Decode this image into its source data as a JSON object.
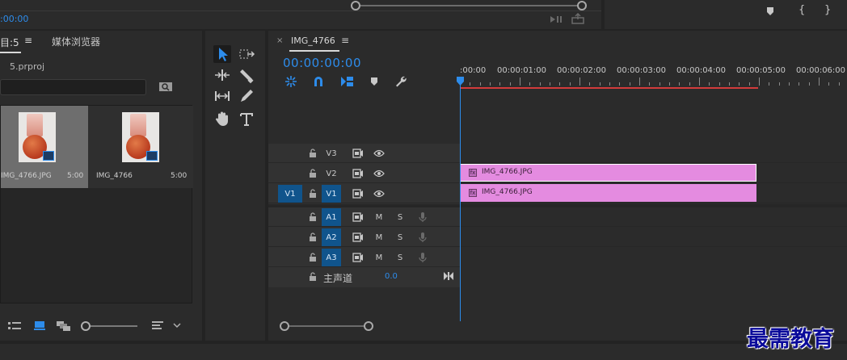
{
  "top": {
    "source_time": ":00:00"
  },
  "project": {
    "tab_label": "目:5",
    "menu_glyph": "≡",
    "media_browser_tab": "媒体浏览器",
    "file_name": "5.prproj",
    "items": [
      {
        "name": "IMG_4766.JPG",
        "duration": "5:00"
      },
      {
        "name": "IMG_4766",
        "duration": "5:00"
      }
    ]
  },
  "timeline": {
    "close_glyph": "×",
    "sequence_name": "IMG_4766",
    "menu_glyph": "≡",
    "timecode": "00:00:00:00",
    "ruler_ticks": [
      ":00:00",
      "00:00:01:00",
      "00:00:02:00",
      "00:00:03:00",
      "00:00:04:00",
      "00:00:05:00",
      "00:00:06:00"
    ],
    "tracks": [
      {
        "id": "V3",
        "kind": "video",
        "source": ""
      },
      {
        "id": "V2",
        "kind": "video",
        "source": ""
      },
      {
        "id": "V1",
        "kind": "video",
        "source": "V1"
      },
      {
        "id": "A1",
        "kind": "audio",
        "mute": "M",
        "solo": "S"
      },
      {
        "id": "A2",
        "kind": "audio",
        "mute": "M",
        "solo": "S"
      },
      {
        "id": "A3",
        "kind": "audio",
        "mute": "M",
        "solo": "S"
      }
    ],
    "master": {
      "label": "主声道",
      "value": "0.0"
    },
    "clips": [
      {
        "track": "V2",
        "name": "IMG_4766.JPG"
      },
      {
        "track": "V1",
        "name": "IMG_4766.JPG"
      }
    ]
  },
  "watermark": "最需教育",
  "colors": {
    "accent_blue": "#2d8ceb",
    "track_target_blue": "#10548c",
    "clip_pink": "#e48be0",
    "work_area_red": "#d23b3b"
  },
  "icons": [
    "select-tool-icon",
    "track-select-icon",
    "ripple-edit-icon",
    "razor-icon",
    "slip-icon",
    "pen-icon",
    "hand-icon",
    "type-icon",
    "snap-icon",
    "linked-selection-icon",
    "add-marker-icon",
    "wrench-icon",
    "lock-icon",
    "toggle-output-icon",
    "eye-icon",
    "mic-icon"
  ]
}
